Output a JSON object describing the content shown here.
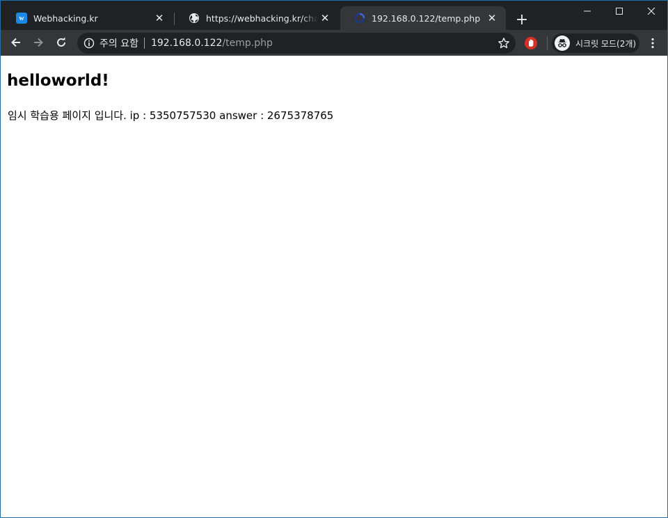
{
  "browser": {
    "tabs": [
      {
        "title": "Webhacking.kr",
        "favicon": "webhacking-w-icon",
        "favicon_letter": "w",
        "active": false
      },
      {
        "title": "https://webhacking.kr/challenge",
        "favicon": "globe-icon",
        "active": false
      },
      {
        "title": "192.168.0.122/temp.php",
        "favicon": "loading-icon",
        "active": true
      }
    ],
    "new_tab": "+",
    "close_glyph": "✕",
    "address": {
      "security_label": "주의 요함",
      "host": "192.168.0.122",
      "path": "/temp.php"
    },
    "incognito_label": "시크릿 모드(2개)",
    "colors": {
      "frame": "#202124",
      "toolbar": "#35363a",
      "accent": "#1e88e5"
    }
  },
  "page": {
    "heading": "helloworld!",
    "body_text": "임시 학습용 페이지 입니다. ip : 5350757530 answer : 2675378765"
  }
}
